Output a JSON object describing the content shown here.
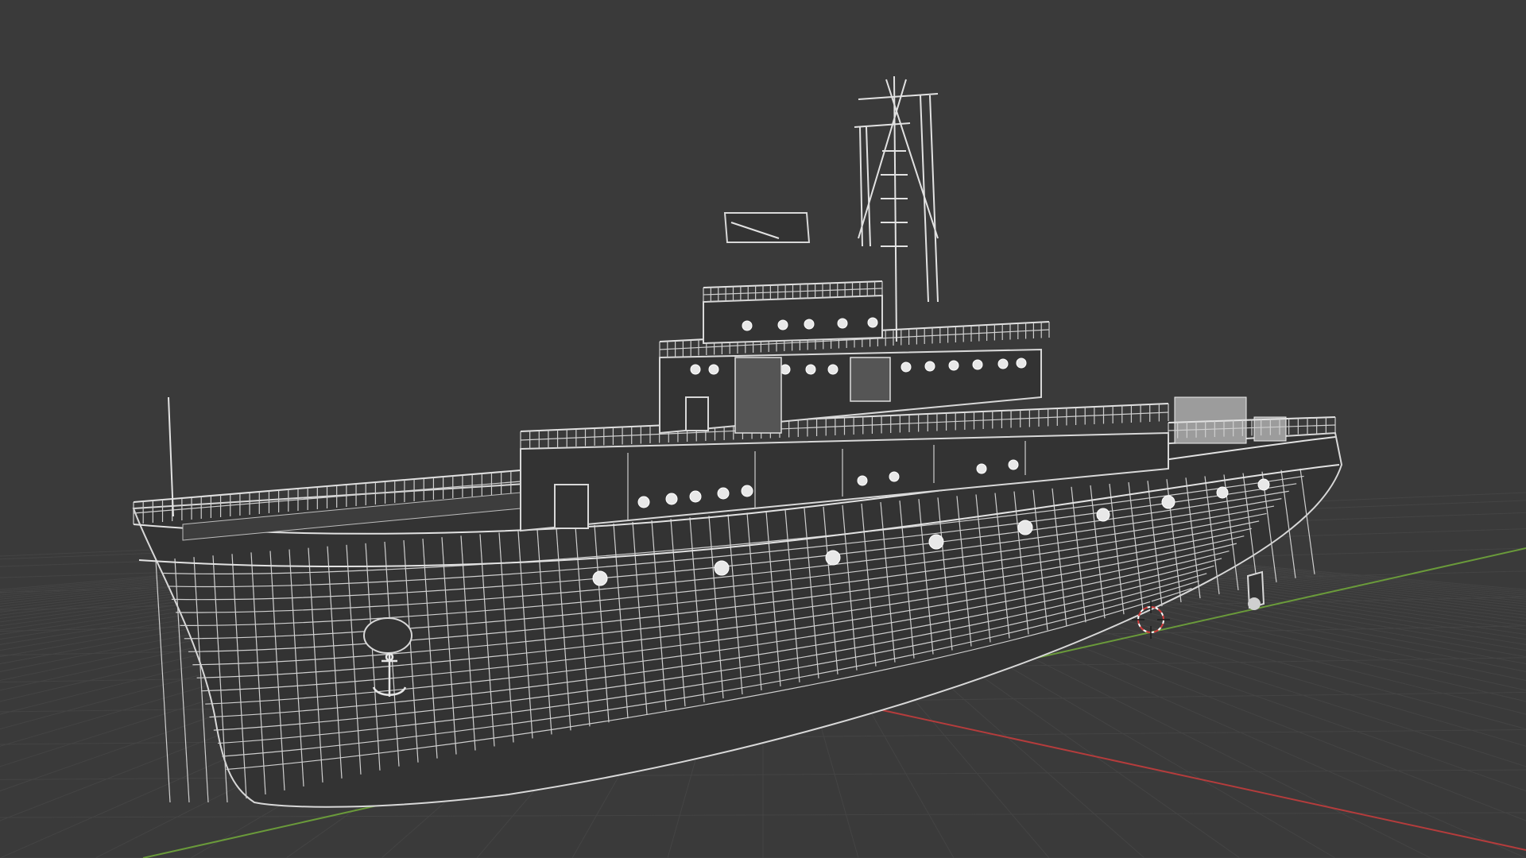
{
  "viewport": {
    "background": "#3a3a3a",
    "mode": "wireframe",
    "object": "tugboat-mesh",
    "wire_color": "#d8d8d8",
    "axis_x_color": "#b43c3c",
    "axis_y_color": "#6a9a3a"
  },
  "icons": {
    "cursor_3d": "3d-cursor-icon",
    "anchor": "anchor-icon"
  }
}
